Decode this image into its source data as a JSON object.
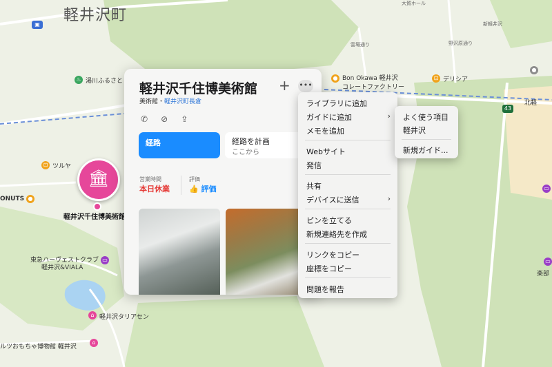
{
  "map": {
    "city_label": "軽井沢町",
    "labels": [
      {
        "id": "yugawa",
        "text": "湯川ふるさと"
      },
      {
        "id": "tsuruya",
        "text": "ツルヤ"
      },
      {
        "id": "onuts",
        "text": "ONUTS"
      },
      {
        "id": "tokyu",
        "text": "東急ハーヴェストクラブ"
      },
      {
        "id": "tokyu2",
        "text": "軽井沢&VIALA"
      },
      {
        "id": "taliesin",
        "text": "軽井沢タリアセン"
      },
      {
        "id": "omocha",
        "text": "ルツおもちゃ博物館 軽井沢"
      },
      {
        "id": "bonokawa",
        "text": "Bon Okawa 軽井沢"
      },
      {
        "id": "bonokawa2",
        "text": "コレートファクトリー"
      },
      {
        "id": "delicia",
        "text": "デリシア"
      },
      {
        "id": "kitakaruizawa",
        "text": "北軽"
      },
      {
        "id": "road43",
        "text": "43"
      },
      {
        "id": "gakubu",
        "text": "楽部"
      },
      {
        "id": "kumoba",
        "text": "雲場通り"
      },
      {
        "id": "nokai",
        "text": "野沢原通り"
      },
      {
        "id": "ohga",
        "text": "大賀ホール"
      },
      {
        "id": "shinjin",
        "text": "新軽井沢"
      }
    ],
    "pin_label": "軽井沢千住博美術館"
  },
  "card": {
    "title": "軽井沢千住博美術館",
    "category": "美術館",
    "sep": "・",
    "location": "軽井沢町長倉",
    "add_icon": "+",
    "more_icon": "•••",
    "route_label": "経路",
    "plan_label": "経路を計画",
    "plan_sub": "ここから",
    "hours_header": "営業時間",
    "hours_value": "本日休業",
    "rating_header": "評価",
    "rating_value": "評価",
    "colors": {
      "accent": "#1a8cff",
      "closed": "#e53935",
      "pin": "#e6479a"
    }
  },
  "menu": {
    "items": [
      "ライブラリに追加",
      "ガイドに追加",
      "メモを追加",
      "Webサイト",
      "発信",
      "共有",
      "デバイスに送信",
      "ピンを立てる",
      "新規連絡先を作成",
      "リンクをコピー",
      "座標をコピー",
      "問題を報告"
    ]
  },
  "submenu": {
    "items": [
      "よく使う項目",
      "軽井沢",
      "新規ガイド..."
    ]
  }
}
